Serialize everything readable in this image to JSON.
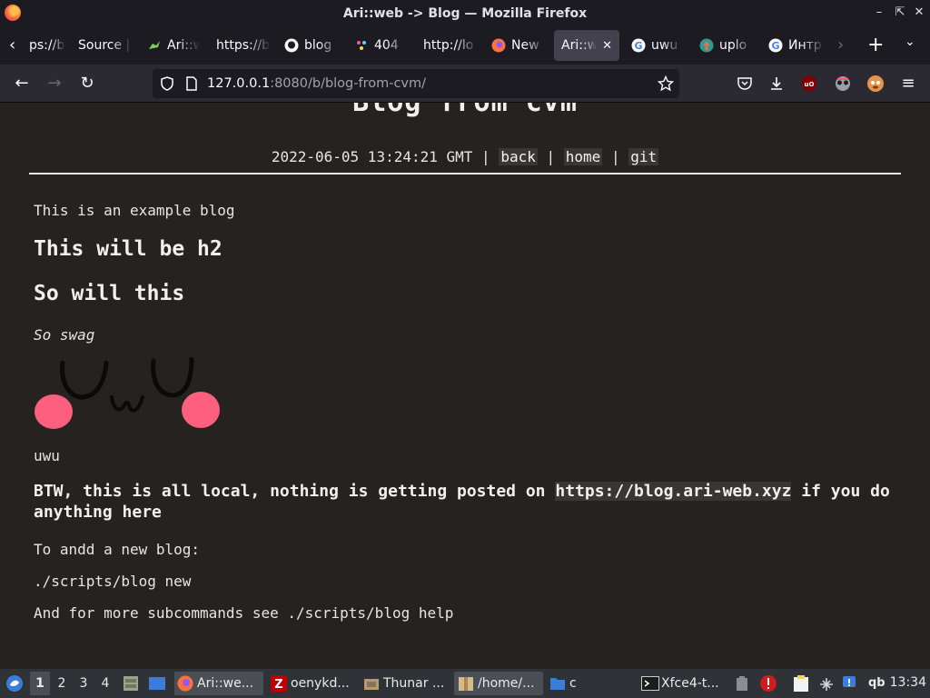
{
  "window": {
    "title": "Ari::web -> Blog — Mozilla Firefox"
  },
  "tabs": [
    {
      "label": "ps://b",
      "favicon": "none"
    },
    {
      "label": "Source |",
      "favicon": "none"
    },
    {
      "label": "Ari::w",
      "favicon": "lizard-icon"
    },
    {
      "label": "https://b",
      "favicon": "none"
    },
    {
      "label": "blog",
      "favicon": "github-icon"
    },
    {
      "label": "404",
      "favicon": "dots-icon"
    },
    {
      "label": "http://lo",
      "favicon": "none"
    },
    {
      "label": "New",
      "favicon": "firefox-icon"
    },
    {
      "label": "Ari::we",
      "favicon": "none",
      "active": true
    },
    {
      "label": "uwu",
      "favicon": "google-icon"
    },
    {
      "label": "uplo",
      "favicon": "upload-icon"
    },
    {
      "label": "Интр",
      "favicon": "google-icon"
    }
  ],
  "navbar": {
    "url_host": "127.0.0.1",
    "url_rest": ":8080/b/blog-from-cvm/"
  },
  "page": {
    "title": "Blog from cvm",
    "date": "2022-06-05 13:24:21 GMT",
    "sep": "|",
    "link_back": "back",
    "link_home": "home",
    "link_git": "git",
    "intro": "This is an example blog",
    "h2_a": "This will be h2",
    "h2_b": "So will this",
    "italic": "So swag",
    "caption": "uwu",
    "btw_before": "BTW, this is all local, nothing is getting posted on ",
    "btw_link": "https://blog.ari-web.xyz",
    "btw_after": " if you do anything here",
    "add_label": "To andd a new blog:",
    "add_cmd": "./scripts/blog new",
    "more": "And for more subcommands see ./scripts/blog help"
  },
  "taskbar": {
    "workspaces": [
      "1",
      "2",
      "3",
      "4"
    ],
    "items": [
      {
        "label": "Ari::we..."
      },
      {
        "label": "oenykd..."
      },
      {
        "label": "Thunar ..."
      },
      {
        "label": "/home/..."
      },
      {
        "label": "c"
      },
      {
        "label": "Xfce4-t..."
      }
    ],
    "tray_text": "qb",
    "clock": "13:34"
  }
}
